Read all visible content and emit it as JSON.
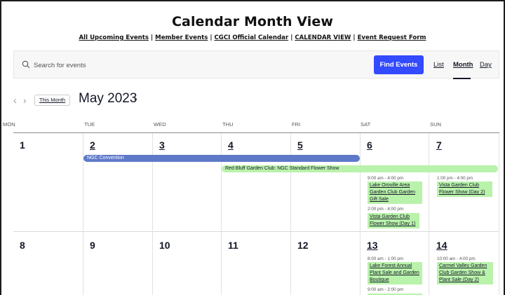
{
  "header": {
    "title": "Calendar Month View",
    "links": [
      "All Upcoming Events",
      "Member Events",
      "CGCI Official Calendar",
      "CALENDAR VIEW",
      "Event Request Form"
    ]
  },
  "search": {
    "placeholder": "Search for events",
    "button_label": "Find Events",
    "views": [
      "List",
      "Month",
      "Day"
    ],
    "active_view": "Month"
  },
  "month_nav": {
    "prev_icon": "chevron-left-icon",
    "next_icon": "chevron-right-icon",
    "this_month_label": "This Month",
    "month_label": "May 2023",
    "caret": "⌄"
  },
  "weekdays": [
    "MON",
    "TUE",
    "WED",
    "THU",
    "FRI",
    "SAT",
    "SUN"
  ],
  "week1": {
    "days": [
      "1",
      "2",
      "3",
      "4",
      "5",
      "6",
      "7"
    ],
    "multi_day_events": [
      {
        "title": "NGC Convention",
        "color": "#5f79c9"
      },
      {
        "title": "Red Bluff Garden Club: NGC Standard Flower Show",
        "color": "#b9f2ab"
      }
    ],
    "sat_events": [
      {
        "time": "9:00 am - 4:00 pm",
        "title": "Lake Oroville Area Garden Club Garden Gift Sale"
      },
      {
        "time": "2:00 pm - 4:00 pm",
        "title": "Vista Garden Club Flower Show (Day 1)"
      }
    ],
    "sun_events": [
      {
        "time": "1:00 pm - 4:00 pm",
        "title": "Vista Garden Club Flower Show (Day 2)"
      }
    ]
  },
  "week2": {
    "days": [
      "8",
      "9",
      "10",
      "11",
      "12",
      "13",
      "14"
    ],
    "sat_events": [
      {
        "time": "8:00 am - 1:00 pm",
        "title": "Lake Forest Annual Plant Sale and Garden Boutique"
      },
      {
        "time": "9:00 am - 2:00 pm",
        "title": ""
      }
    ],
    "sun_events": [
      {
        "time": "10:00 am - 4:00 pm",
        "title": "Carmel Valley Garden Club Garden Show & Plant Sale (Day 2)"
      }
    ]
  },
  "colors": {
    "accent": "#334aff",
    "event_green": "#b9f2ab",
    "event_blue": "#5f79c9"
  }
}
